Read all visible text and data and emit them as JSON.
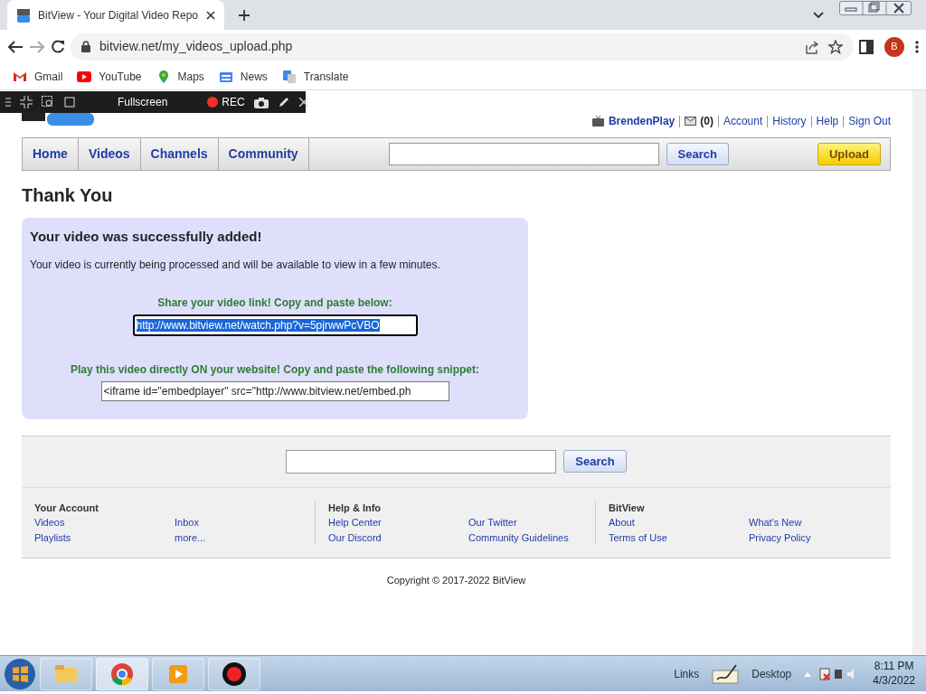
{
  "browser": {
    "tab_title": "BitView - Your Digital Video Repo",
    "url": "bitview.net/my_videos_upload.php",
    "profile": "B",
    "bookmarks": [
      {
        "kind": "gmail",
        "label": "Gmail"
      },
      {
        "kind": "youtube",
        "label": "YouTube"
      },
      {
        "kind": "maps",
        "label": "Maps"
      },
      {
        "kind": "news",
        "label": "News"
      },
      {
        "kind": "translate",
        "label": "Translate"
      }
    ]
  },
  "recorder": {
    "mode": "Fullscreen",
    "rec": "REC"
  },
  "user_bar": {
    "username": "BrendenPlay",
    "inbox_count": "(0)",
    "links": [
      "Account",
      "History",
      "Help",
      "Sign Out"
    ]
  },
  "nav": {
    "items": [
      "Home",
      "Videos",
      "Channels",
      "Community"
    ],
    "search_button": "Search",
    "upload_button": "Upload"
  },
  "heading": "Thank You",
  "notice": {
    "title": "Your video was successfully added!",
    "message": "Your video is currently being processed and will be available to view in a few minutes.",
    "share_label": "Share your video link! Copy and paste below:",
    "share_url": {
      "value": "http://www.bitview.net/watch.php?v=5pjrwwPcVBO",
      "selected": true
    },
    "embed_label": "Play this video directly ON your website! Copy and paste the following snippet:",
    "embed_code": {
      "value": "<iframe id=\"embedplayer\" src=\"http://www.bitview.net/embed.ph",
      "selected": false
    }
  },
  "footer_search": {
    "button": "Search"
  },
  "footer": [
    {
      "title": "Your Account",
      "links": [
        "Videos",
        "Inbox",
        "Playlists",
        "more..."
      ]
    },
    {
      "title": "Help & Info",
      "links": [
        "Help Center",
        "Our Twitter",
        "Our Discord",
        "Community Guidelines"
      ]
    },
    {
      "title": "BitView",
      "links": [
        "About",
        "What's New",
        "Terms of Use",
        "Privacy Policy"
      ]
    }
  ],
  "copyright": "Copyright © 2017-2022 BitView",
  "taskbar": {
    "apps": [
      {
        "kind": "explorer",
        "active": false
      },
      {
        "kind": "chrome",
        "active": true
      },
      {
        "kind": "media",
        "active": false
      },
      {
        "kind": "recorder",
        "active": false
      }
    ],
    "toolbars": [
      "Links",
      "Desktop"
    ],
    "time": "8:11 PM",
    "date": "4/3/2022"
  }
}
